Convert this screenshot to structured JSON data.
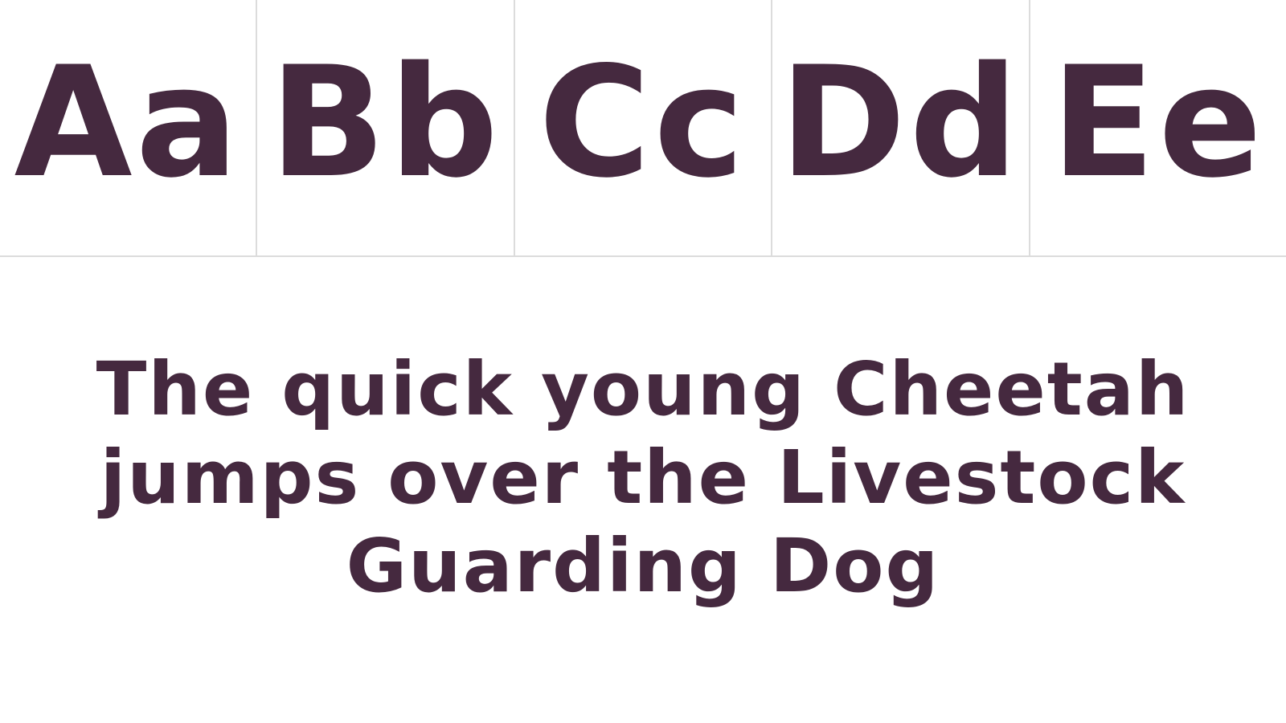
{
  "glyph_pairs": [
    "Aa",
    "Bb",
    "Cc",
    "Dd",
    "Ee"
  ],
  "pangram": {
    "line1": "The quick young Cheetah",
    "line2": "jumps over the Livestock",
    "line3": "Guarding Dog"
  },
  "colors": {
    "ink": "#45293f",
    "background": "#ffffff",
    "divider": "#dcdcdc"
  },
  "decoration": "paw-print-icon"
}
